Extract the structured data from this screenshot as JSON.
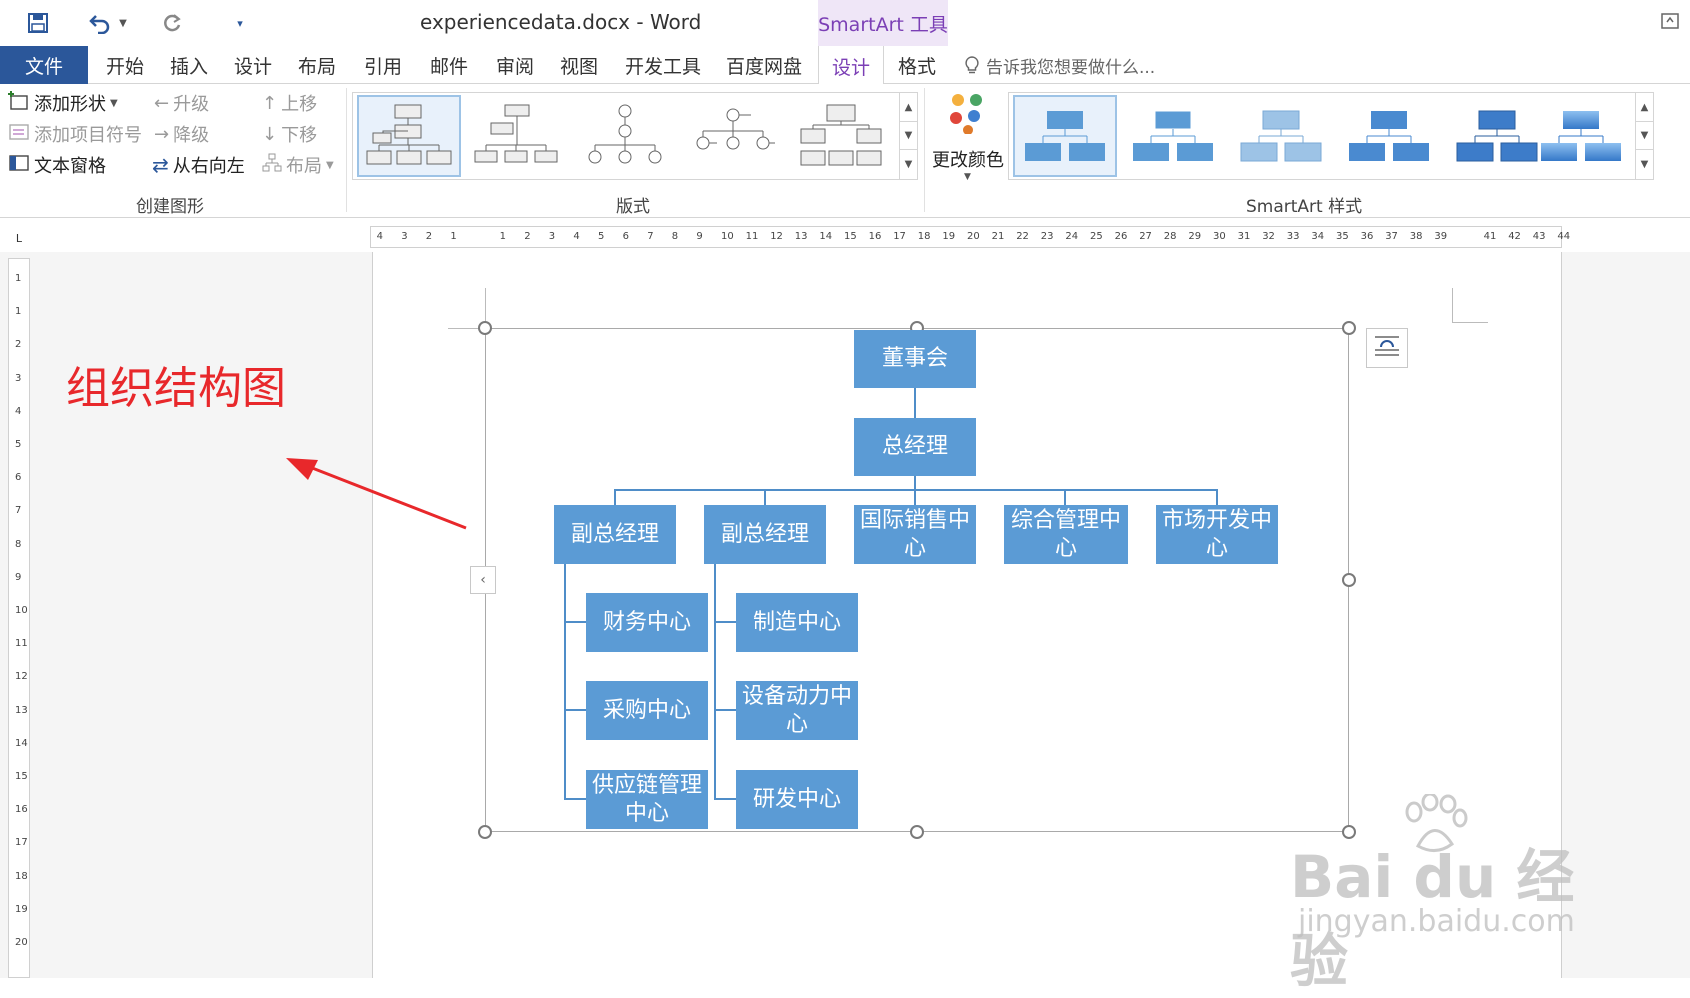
{
  "titlebar": {
    "doc_title": "experiencedata.docx - Word",
    "contextual_tab_group": "SmartArt 工具"
  },
  "tabs": [
    {
      "label": "文件"
    },
    {
      "label": "开始"
    },
    {
      "label": "插入"
    },
    {
      "label": "设计"
    },
    {
      "label": "布局"
    },
    {
      "label": "引用"
    },
    {
      "label": "邮件"
    },
    {
      "label": "审阅"
    },
    {
      "label": "视图"
    },
    {
      "label": "开发工具"
    },
    {
      "label": "百度网盘"
    },
    {
      "label": "设计"
    },
    {
      "label": "格式"
    }
  ],
  "tell_me": "告诉我您想要做什么...",
  "ribbon": {
    "create_graphic": {
      "add_shape": "添加形状",
      "add_bullet": "添加项目符号",
      "text_pane": "文本窗格",
      "promote": "升级",
      "demote": "降级",
      "right_to_left": "从右向左",
      "move_up": "上移",
      "move_down": "下移",
      "layout": "布局",
      "group_label": "创建图形"
    },
    "layouts": {
      "group_label": "版式"
    },
    "styles": {
      "change_colors": "更改颜色",
      "group_label": "SmartArt 样式"
    }
  },
  "ruler": {
    "left_numbers": [
      "4",
      "3",
      "2",
      "1"
    ],
    "right_numbers": [
      "1",
      "2",
      "3",
      "4",
      "5",
      "6",
      "7",
      "8",
      "9",
      "10",
      "11",
      "12",
      "13",
      "14",
      "15",
      "16",
      "17",
      "18",
      "19",
      "20",
      "21",
      "22",
      "23",
      "24",
      "25",
      "26",
      "27",
      "28",
      "29",
      "30",
      "31",
      "32",
      "33",
      "34",
      "35",
      "36",
      "37",
      "38",
      "39"
    ],
    "tail_numbers": [
      "41",
      "42",
      "43",
      "44"
    ],
    "vertical_numbers": [
      "1",
      "1",
      "2",
      "3",
      "4",
      "5",
      "6",
      "7",
      "8",
      "9",
      "10",
      "11",
      "12",
      "13",
      "14",
      "15",
      "16",
      "17",
      "18",
      "19",
      "20"
    ]
  },
  "annotation": "组织结构图",
  "org_chart": {
    "root": "董事会",
    "gm": "总经理",
    "vp1": "副总经理",
    "vp2": "副总经理",
    "intl_sales": "国际销售中心",
    "general_mgmt": "综合管理中心",
    "market_dev": "市场开发中心",
    "finance": "财务中心",
    "purchasing": "采购中心",
    "supply_chain": "供应链管理中心",
    "manufacturing": "制造中心",
    "equipment_power": "设备动力中心",
    "rnd": "研发中心"
  },
  "watermark": {
    "logo": "Bai du 经验",
    "url": "jingyan.baidu.com"
  }
}
